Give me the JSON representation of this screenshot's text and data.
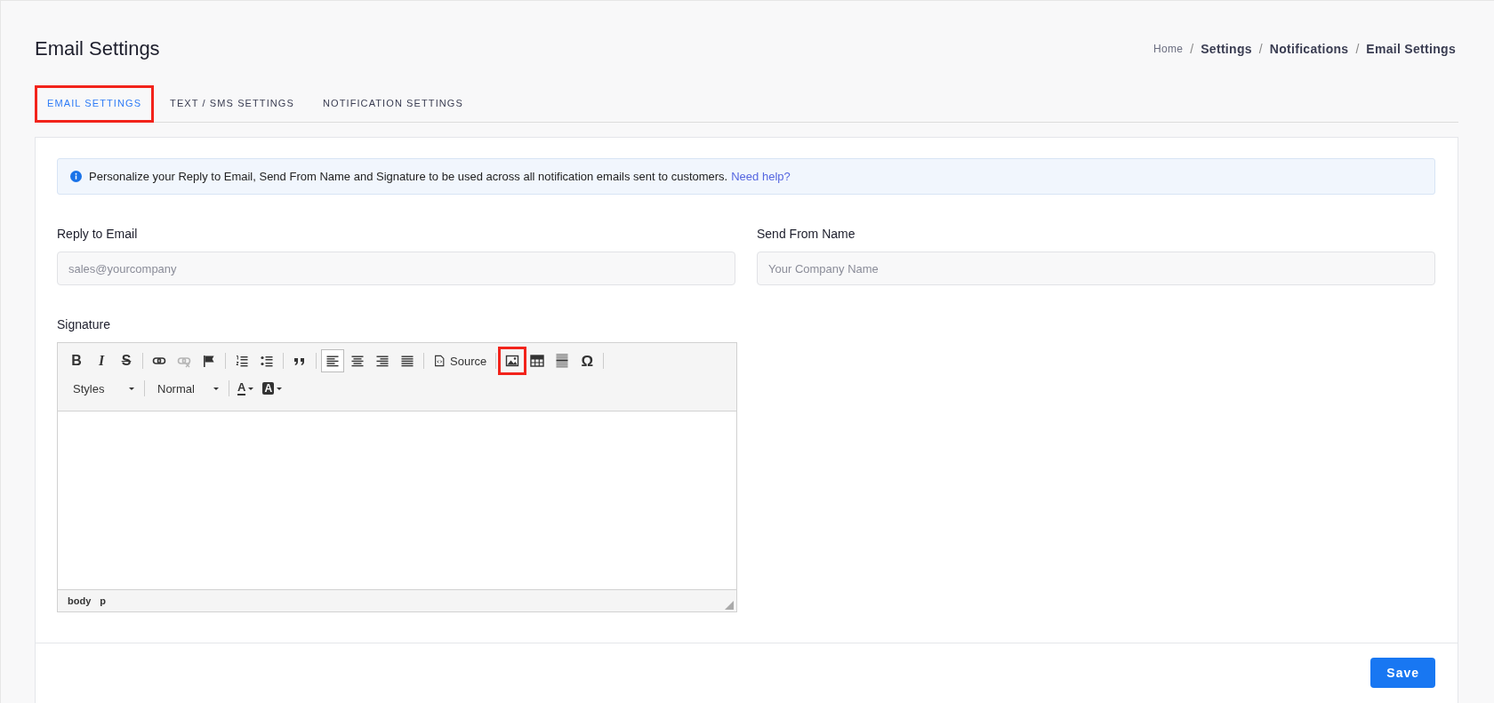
{
  "page": {
    "title": "Email Settings"
  },
  "breadcrumb": [
    {
      "label": "Home",
      "bold": false
    },
    {
      "separator": "/",
      "label": "Settings",
      "bold": true
    },
    {
      "separator": "/",
      "label": "Notifications",
      "bold": true
    },
    {
      "separator": "/",
      "label": "Email Settings",
      "bold": true
    }
  ],
  "tabs": [
    {
      "label": "EMAIL SETTINGS",
      "selected": true,
      "highlighted": true
    },
    {
      "label": "TEXT / SMS SETTINGS",
      "selected": false,
      "highlighted": false
    },
    {
      "label": "NOTIFICATION SETTINGS",
      "selected": false,
      "highlighted": false
    }
  ],
  "info": {
    "text": "Personalize your Reply to Email, Send From Name and Signature to be used across all notification emails sent to customers.",
    "link": "Need help?"
  },
  "fields": [
    {
      "label": "Reply to Email",
      "placeholder": "sales@yourcompany"
    },
    {
      "label": "Send From Name",
      "placeholder": "Your Company Name"
    }
  ],
  "signature": {
    "label": "Signature",
    "toolbar": [
      [
        {
          "kind": "bold",
          "label": "B",
          "selected": false,
          "disabled": false,
          "highlighted": false
        },
        {
          "kind": "italic",
          "label": "I",
          "selected": false,
          "disabled": false,
          "highlighted": false
        },
        {
          "kind": "strike",
          "label": "S",
          "selected": false,
          "disabled": false,
          "highlighted": false
        }
      ],
      [
        {
          "kind": "link",
          "selected": false,
          "disabled": false,
          "highlighted": false
        },
        {
          "kind": "unlink",
          "selected": false,
          "disabled": true,
          "highlighted": false
        },
        {
          "kind": "anchor",
          "selected": false,
          "disabled": false,
          "highlighted": false
        }
      ],
      [
        {
          "kind": "ordered-list",
          "selected": false,
          "disabled": false,
          "highlighted": false
        },
        {
          "kind": "bullet-list",
          "selected": false,
          "disabled": false,
          "highlighted": false
        }
      ],
      [
        {
          "kind": "quote",
          "selected": false,
          "disabled": false,
          "highlighted": false
        }
      ],
      [
        {
          "kind": "align-left",
          "selected": true,
          "disabled": false,
          "highlighted": false
        },
        {
          "kind": "align-center",
          "selected": false,
          "disabled": false,
          "highlighted": false
        },
        {
          "kind": "align-right",
          "selected": false,
          "disabled": false,
          "highlighted": false
        },
        {
          "kind": "justify",
          "selected": false,
          "disabled": false,
          "highlighted": false
        }
      ],
      [
        {
          "kind": "source",
          "label": "Source",
          "selected": false,
          "disabled": false,
          "highlighted": false
        }
      ],
      [
        {
          "kind": "image",
          "selected": false,
          "disabled": false,
          "highlighted": true
        },
        {
          "kind": "table",
          "selected": false,
          "disabled": false,
          "highlighted": false
        },
        {
          "kind": "horizontal-line",
          "selected": false,
          "disabled": false,
          "highlighted": false
        },
        {
          "kind": "special-char",
          "label": "Ω",
          "selected": false,
          "disabled": false,
          "highlighted": false
        }
      ]
    ],
    "dropdowns": [
      {
        "kind": "combo",
        "label": "Styles"
      },
      {
        "kind": "combo",
        "label": "Normal"
      },
      {
        "kind": "text-color",
        "label": "A"
      },
      {
        "kind": "bg-color",
        "label": "A"
      }
    ],
    "path": [
      "body",
      "p"
    ]
  },
  "save_button": "Save"
}
